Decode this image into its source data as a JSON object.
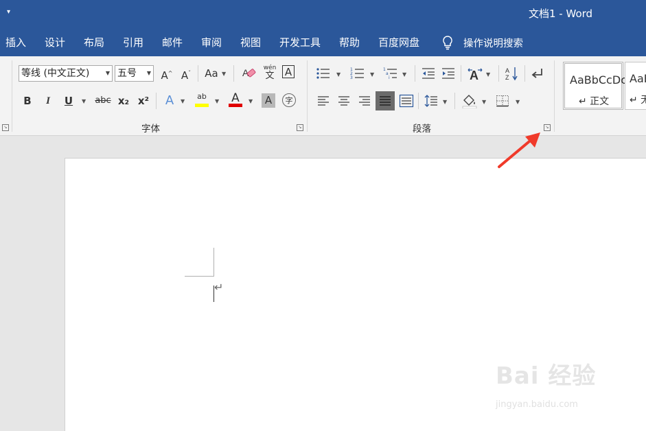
{
  "titlebar": {
    "quick_access": "▾",
    "title": "文档1  -  Word"
  },
  "menu": {
    "items": [
      "插入",
      "设计",
      "布局",
      "引用",
      "邮件",
      "审阅",
      "视图",
      "开发工具",
      "帮助",
      "百度网盘"
    ],
    "tell_me": "操作说明搜索"
  },
  "ribbon": {
    "font": {
      "font_name": "等线 (中文正文)",
      "font_size": "五号",
      "label": "字体",
      "bold": "B",
      "italic": "I",
      "underline": "U",
      "strike": "abc",
      "subscript": "x₂",
      "superscript": "x²",
      "grow": "A",
      "shrink": "A",
      "change_case": "Aa",
      "phonetic_top": "wén",
      "phonetic_bottom": "文",
      "border_char": "A",
      "text_effect": "A",
      "highlight": "ab",
      "font_color": "A",
      "shading": "A",
      "enclose": "字"
    },
    "paragraph": {
      "label": "段落"
    },
    "styles": [
      {
        "sample": "AaBbCcDc",
        "name": "↵ 正文"
      },
      {
        "sample": "AaBl",
        "name": "↵ 无"
      }
    ]
  },
  "colors": {
    "titlebar": "#2b579a",
    "highlight": "#ffff00",
    "font_color": "#e00000",
    "annotation": "#f03a2a"
  },
  "watermark": {
    "logo": "Bai 经验",
    "url": "jingyan.baidu.com"
  }
}
